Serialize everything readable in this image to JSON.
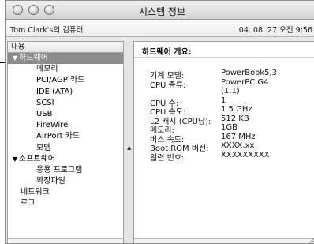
{
  "window": {
    "title": "시스템 정보"
  },
  "infobar": {
    "computer_name": "Tom Clark's의 컴퓨터",
    "datetime": "04. 08. 27 오전 9:56"
  },
  "sidebar": {
    "header": "내용",
    "items": [
      {
        "label": "하드웨어",
        "expanded": true,
        "selected": true
      },
      {
        "label": "메모리"
      },
      {
        "label": "PCI/AGP 카드"
      },
      {
        "label": "IDE (ATA)"
      },
      {
        "label": "SCSI"
      },
      {
        "label": "USB"
      },
      {
        "label": "FireWire"
      },
      {
        "label": "AirPort 카드"
      },
      {
        "label": "모뎀"
      },
      {
        "label": "소프트웨어",
        "expanded": true
      },
      {
        "label": "응용 프로그램"
      },
      {
        "label": "확장파일"
      },
      {
        "label": "네트워크"
      },
      {
        "label": "로그"
      }
    ],
    "expand_glyph": "▼"
  },
  "detail": {
    "title": "하드웨어 개요:",
    "rows": [
      {
        "key": "기계 모델:",
        "value": "PowerBook5,3"
      },
      {
        "key": "CPU 종류:",
        "value": "PowerPC G4",
        "value2": "(1.1)"
      },
      {
        "key": "CPU 수:",
        "value": "1"
      },
      {
        "key": "CPU 속도:",
        "value": "1.5 GHz"
      },
      {
        "key": "L2 캐시 (CPU당):",
        "value": "512 KB"
      },
      {
        "key": "메모리:",
        "value": "1GB"
      },
      {
        "key": "버스 속도:",
        "value": "167 MHz"
      },
      {
        "key": "Boot ROM 버전:",
        "value": "XXXX.xx"
      },
      {
        "key": "일련 번호:",
        "value": "XXXXXXXXX"
      }
    ]
  }
}
